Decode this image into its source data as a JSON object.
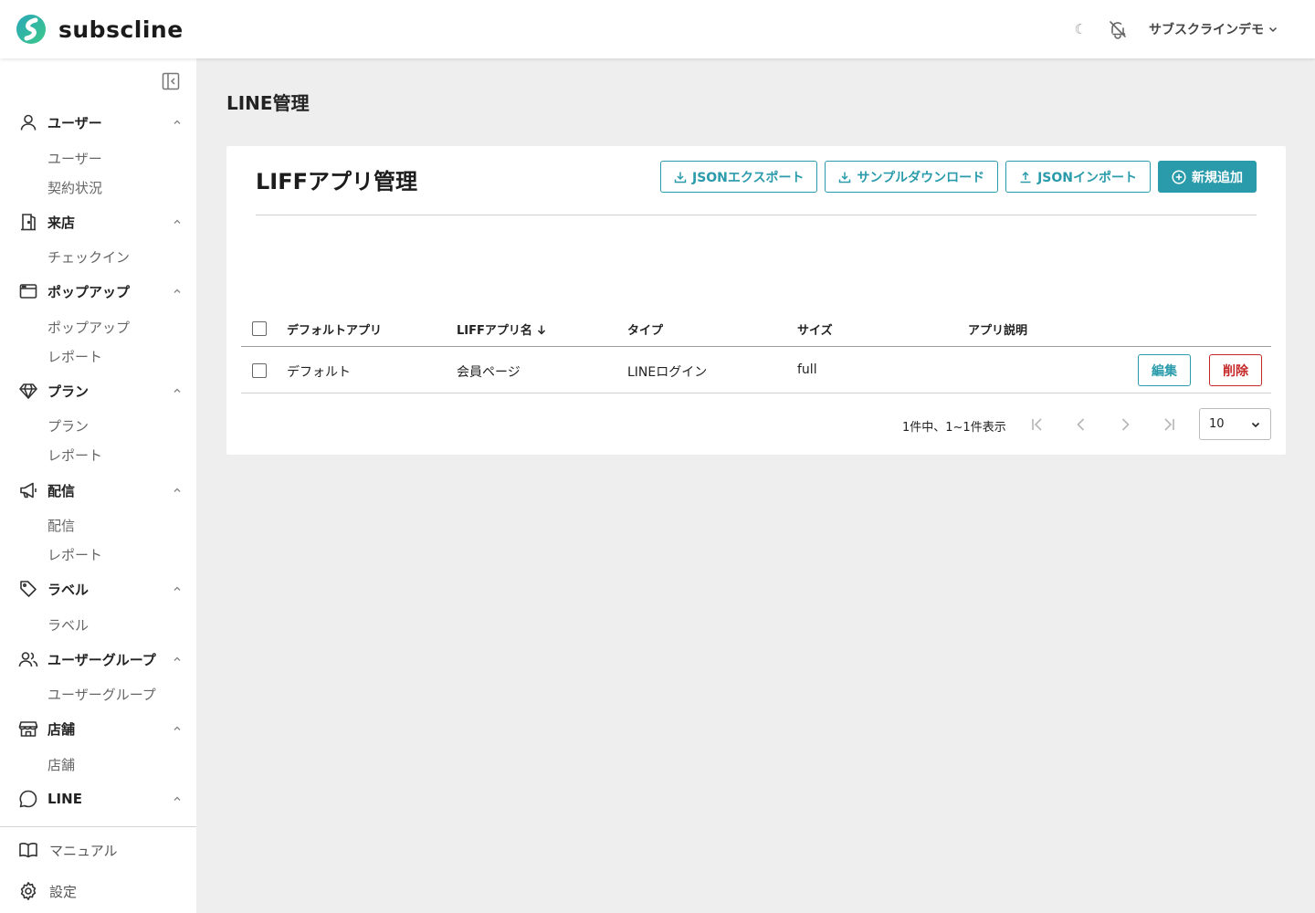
{
  "app": {
    "name": "subscline"
  },
  "header": {
    "theme_glyph": "☾",
    "org_name": "サブスクラインデモ"
  },
  "sidebar": {
    "groups": [
      {
        "label": "ユーザー",
        "icon": "user-icon",
        "items": [
          "ユーザー",
          "契約状況"
        ]
      },
      {
        "label": "来店",
        "icon": "door-icon",
        "items": [
          "チェックイン"
        ]
      },
      {
        "label": "ポップアップ",
        "icon": "window-icon",
        "items": [
          "ポップアップ",
          "レポート"
        ]
      },
      {
        "label": "プラン",
        "icon": "diamond-icon",
        "items": [
          "プラン",
          "レポート"
        ]
      },
      {
        "label": "配信",
        "icon": "megaphone-icon",
        "items": [
          "配信",
          "レポート"
        ]
      },
      {
        "label": "ラベル",
        "icon": "tag-icon",
        "items": [
          "ラベル"
        ]
      },
      {
        "label": "ユーザーグループ",
        "icon": "users-icon",
        "items": [
          "ユーザーグループ"
        ]
      },
      {
        "label": "店舗",
        "icon": "store-icon",
        "items": [
          "店舗"
        ]
      },
      {
        "label": "LINE",
        "icon": "chat-bubble-icon",
        "items": []
      }
    ],
    "bottom": [
      {
        "label": "マニュアル",
        "icon": "book-icon"
      },
      {
        "label": "設定",
        "icon": "gear-icon"
      }
    ]
  },
  "main": {
    "page_title": "LINE管理",
    "card_title": "LIFFアプリ管理",
    "buttons": {
      "export": "JSONエクスポート",
      "sample": "サンプルダウンロード",
      "import": "JSONインポート",
      "add": "新規追加"
    },
    "table": {
      "columns": [
        "デフォルトアプリ",
        "LIFFアプリ名",
        "タイプ",
        "サイズ",
        "アプリ説明"
      ],
      "rows": [
        {
          "default": "デフォルト",
          "name": "会員ページ",
          "type": "LINEログイン",
          "size": "full",
          "description": ""
        }
      ],
      "actions": {
        "edit": "編集",
        "delete": "削除"
      }
    },
    "pagination": {
      "range_text": "1件中、1~1件表示",
      "page_size": "10"
    }
  },
  "colors": {
    "accent": "#2a9bab",
    "danger": "#c62828",
    "background": "#eeeeee"
  }
}
